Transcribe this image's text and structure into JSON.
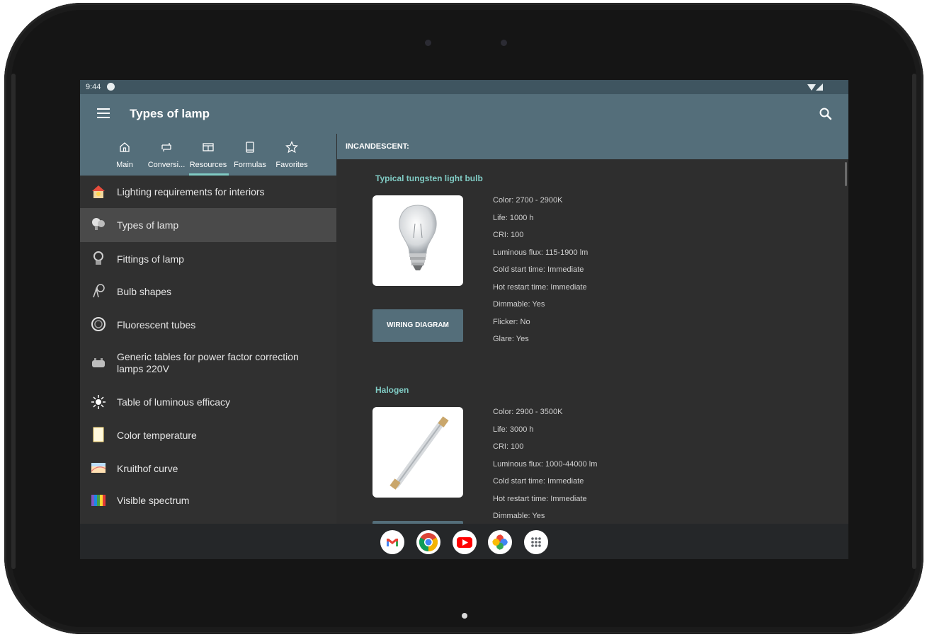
{
  "status_bar": {
    "time": "9:44"
  },
  "app_bar": {
    "title": "Types of lamp",
    "menu_icon": "hamburger-menu-icon",
    "search_icon": "search-icon"
  },
  "tabs": [
    {
      "label": "Main",
      "icon": "home-icon"
    },
    {
      "label": "Conversi...",
      "icon": "conversion-icon"
    },
    {
      "label": "Resources",
      "icon": "resources-icon",
      "selected": true
    },
    {
      "label": "Formulas",
      "icon": "book-icon"
    },
    {
      "label": "Favorites",
      "icon": "star-icon"
    }
  ],
  "menu": [
    {
      "label": "Lighting requirements for interiors",
      "icon": "house-lamp-icon"
    },
    {
      "label": "Types of lamp",
      "icon": "bulbs-icon",
      "active": true
    },
    {
      "label": "Fittings of lamp",
      "icon": "lamp-fitting-icon"
    },
    {
      "label": "Bulb shapes",
      "icon": "bulb-shapes-icon"
    },
    {
      "label": "Fluorescent tubes",
      "icon": "fluorescent-tube-icon"
    },
    {
      "label": "Generic tables for power factor correction lamps 220V",
      "icon": "capacitor-icon"
    },
    {
      "label": "Table of luminous efficacy",
      "icon": "sun-icon"
    },
    {
      "label": "Color temperature",
      "icon": "color-temperature-icon"
    },
    {
      "label": "Kruithof curve",
      "icon": "kruithof-curve-icon"
    },
    {
      "label": "Visible spectrum",
      "icon": "spectrum-icon"
    }
  ],
  "section_header": "INCANDESCENT:",
  "lamps": [
    {
      "title": "Typical tungsten light bulb",
      "image": "incandescent-bulb-image",
      "button": "WIRING DIAGRAM",
      "properties": [
        "Color: 2700 - 2900K",
        "Life: 1000 h",
        "CRI: 100",
        "Luminous flux: 115-1900 lm",
        "Cold start time: Immediate",
        "Hot restart time: Immediate",
        "Dimmable: Yes",
        "Flicker: No",
        "Glare: Yes"
      ]
    },
    {
      "title": "Halogen",
      "image": "halogen-tube-image",
      "properties": [
        "Color: 2900 - 3500K",
        "Life: 3000 h",
        "CRI: 100",
        "Luminous flux: 1000-44000 lm",
        "Cold start time: Immediate",
        "Hot restart time: Immediate",
        "Dimmable: Yes"
      ]
    }
  ],
  "taskbar": [
    {
      "name": "gmail-icon"
    },
    {
      "name": "chrome-icon"
    },
    {
      "name": "youtube-icon"
    },
    {
      "name": "photos-icon"
    },
    {
      "name": "app-drawer-icon"
    }
  ],
  "colors": {
    "primary": "#546e7a",
    "accent": "#80cbc4",
    "background": "#2e2e2e"
  }
}
